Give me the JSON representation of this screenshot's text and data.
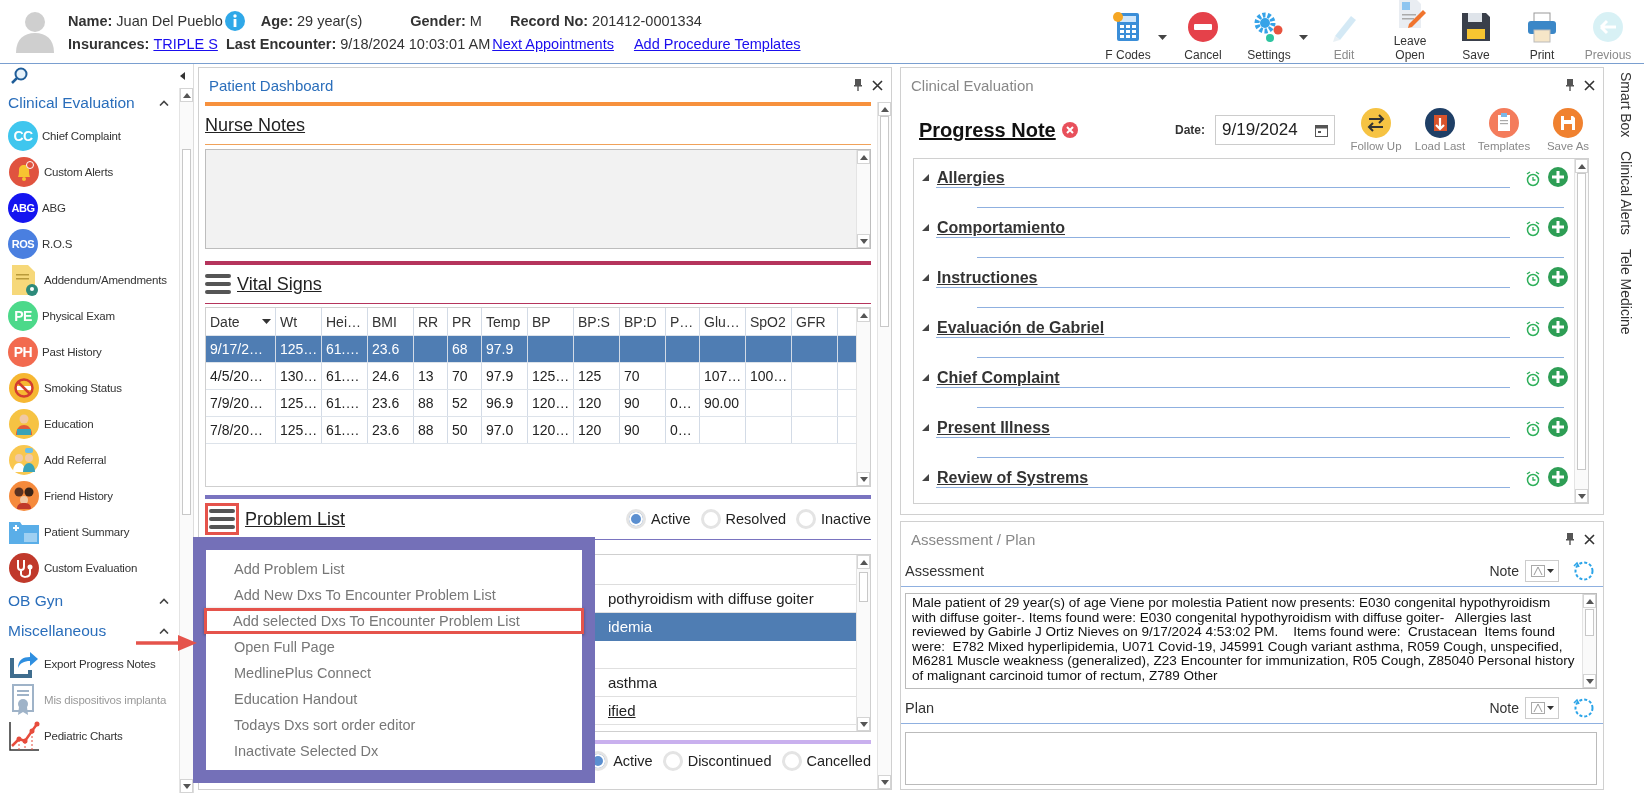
{
  "patient": {
    "name_label": "Name:",
    "name": "Juan Del Pueblo",
    "age_label": "Age:",
    "age": "29 year(s)",
    "gender_label": "Gender:",
    "gender": "M",
    "record_label": "Record No:",
    "record": "201412-0001334",
    "insurance_label": "Insurances:",
    "insurance": "TRIPLE S",
    "last_encounter_label": "Last Encounter:",
    "last_encounter": "9/18/2024 10:03:01 AM",
    "links": [
      "Next Appointments",
      "Add Procedure Templates"
    ]
  },
  "toolbar": [
    {
      "label": "F Codes",
      "kind": "fcodes",
      "dropdown": true,
      "disabled": false
    },
    {
      "label": "Cancel",
      "kind": "cancel",
      "dropdown": false,
      "disabled": false
    },
    {
      "label": "Settings",
      "kind": "settings",
      "dropdown": true,
      "disabled": false
    },
    {
      "label": "Edit",
      "kind": "edit",
      "dropdown": false,
      "disabled": true
    },
    {
      "label": "Leave Open",
      "kind": "leave",
      "dropdown": false,
      "disabled": false
    },
    {
      "label": "Save",
      "kind": "save",
      "dropdown": false,
      "disabled": false
    },
    {
      "label": "Print",
      "kind": "print",
      "dropdown": false,
      "disabled": false
    },
    {
      "label": "Previous",
      "kind": "previous",
      "dropdown": false,
      "disabled": true
    }
  ],
  "sidebar": {
    "groups": [
      {
        "title": "Clinical Evaluation",
        "expanded": true,
        "items": [
          {
            "label": "Chief Complaint",
            "kind": "badge",
            "badge": "CC",
            "color": "#3fc6ee",
            "disabled": false
          },
          {
            "label": "Custom Alerts",
            "kind": "bell",
            "color": "#e0533f",
            "disabled": false
          },
          {
            "label": "ABG",
            "kind": "badge",
            "badge": "ABG",
            "color": "#1414f0",
            "disabled": false
          },
          {
            "label": "R.O.S",
            "kind": "badge",
            "badge": "ROS",
            "color": "#4a7fe0",
            "disabled": false
          },
          {
            "label": "Addendum/Amendments",
            "kind": "document",
            "color": "#f6d87a",
            "disabled": false
          },
          {
            "label": "Physical Exam",
            "kind": "badge",
            "badge": "PE",
            "color": "#4cd98a",
            "disabled": false
          },
          {
            "label": "Past History",
            "kind": "badge",
            "badge": "PH",
            "color": "#f26a4f",
            "disabled": false
          },
          {
            "label": "Smoking Status",
            "kind": "nosmoking",
            "color": "#f6b732",
            "disabled": false
          },
          {
            "label": "Education",
            "kind": "person",
            "color": "#f6c343",
            "disabled": false
          },
          {
            "label": "Add Referral",
            "kind": "people",
            "color": "#f9c74f",
            "disabled": false
          },
          {
            "label": "Friend History",
            "kind": "family",
            "color": "#f58a3c",
            "disabled": false
          },
          {
            "label": "Patient Summary",
            "kind": "folder",
            "color": "#5aaee8",
            "disabled": false
          },
          {
            "label": "Custom Evaluation",
            "kind": "stethoscope",
            "color": "#c0392b",
            "disabled": false
          }
        ]
      },
      {
        "title": "OB Gyn",
        "expanded": true
      },
      {
        "title": "Miscellaneous",
        "expanded": true,
        "items": [
          {
            "label": "Export Progress Notes",
            "kind": "export",
            "color": "#3f6d8e",
            "disabled": false
          },
          {
            "label": "Mis dispositivos implanta",
            "kind": "certificate",
            "color": "#9fb3c8",
            "disabled": true
          },
          {
            "label": "Pediatric Charts",
            "kind": "chart",
            "color": "#e74c3c",
            "disabled": false
          }
        ]
      }
    ]
  },
  "dashboard": {
    "title": "Patient Dashboard",
    "nurse_notes": {
      "title": "Nurse Notes"
    },
    "vital_signs": {
      "title": "Vital Signs",
      "columns": [
        "Date",
        "Wt",
        "Hei…",
        "BMI",
        "RR",
        "PR",
        "Temp",
        "BP",
        "BP:S",
        "BP:D",
        "P…",
        "Glu…",
        "SpO2",
        "GFR"
      ],
      "rows": [
        {
          "selected": true,
          "cells": [
            "9/17/2…",
            "125…",
            "61.…",
            "23.6",
            null,
            "68",
            "97.9",
            null,
            null,
            null,
            null,
            null,
            null,
            null
          ]
        },
        {
          "selected": false,
          "cells": [
            "4/5/20…",
            "130…",
            "61.…",
            "24.6",
            "13",
            "70",
            "97.9",
            "125…",
            "125",
            "70",
            null,
            "107…",
            "100…",
            null
          ]
        },
        {
          "selected": false,
          "cells": [
            "7/9/20…",
            "125…",
            "61.…",
            "23.6",
            "88",
            "52",
            "96.9",
            "120…",
            "120",
            "90",
            "0…",
            "90.00",
            null,
            null
          ]
        },
        {
          "selected": false,
          "cells": [
            "7/8/20…",
            "125…",
            "61.…",
            "23.6",
            "88",
            "50",
            "97.0",
            "120…",
            "120",
            "90",
            "0…",
            null,
            null,
            null
          ]
        }
      ]
    },
    "problem_list": {
      "title": "Problem List",
      "menu_button_highlighted": true,
      "filters": [
        {
          "label": "Active",
          "selected": true
        },
        {
          "label": "Resolved",
          "selected": false
        },
        {
          "label": "Inactive",
          "selected": false
        }
      ],
      "rows": [
        {
          "text": "pothyroidism with diffuse goiter",
          "selected": false,
          "underlined": false
        },
        {
          "text": "idemia",
          "selected": true,
          "underlined": false
        },
        {
          "text": null,
          "selected": false
        },
        {
          "text": "asthma",
          "selected": false,
          "underlined": false
        },
        {
          "text": "ified",
          "selected": false,
          "underlined": true
        }
      ],
      "menu": [
        {
          "label": "Add Problem List",
          "highlighted": false
        },
        {
          "label": "Add New Dxs To Encounter Problem List",
          "highlighted": false
        },
        {
          "label": "Add selected Dxs To Encounter Problem List",
          "highlighted": true
        },
        {
          "label": "Open Full Page",
          "highlighted": false
        },
        {
          "label": "MedlinePlus Connect",
          "highlighted": false
        },
        {
          "label": "Education Handout",
          "highlighted": false
        },
        {
          "label": "Todays Dxs sort order editor",
          "highlighted": false
        },
        {
          "label": "Inactivate Selected Dx",
          "highlighted": false
        }
      ]
    },
    "medications": {
      "filters": [
        {
          "label": "Active",
          "selected": true
        },
        {
          "label": "Discontinued",
          "selected": false
        },
        {
          "label": "Cancelled",
          "selected": false
        }
      ]
    }
  },
  "clinical_evaluation": {
    "title": "Clinical Evaluation",
    "note_title": "Progress Note",
    "date_label": "Date:",
    "date": "9/19/2024",
    "actions": [
      {
        "label": "Follow Up",
        "kind": "follow"
      },
      {
        "label": "Load Last",
        "kind": "load"
      },
      {
        "label": "Templates",
        "kind": "templates"
      },
      {
        "label": "Save As",
        "kind": "saveas"
      }
    ],
    "sections": [
      {
        "title": "Allergies",
        "expanded": true
      },
      {
        "title": "Comportamiento",
        "expanded": true
      },
      {
        "title": "Instructiones",
        "expanded": true
      },
      {
        "title": "Evaluación de Gabriel",
        "expanded": true
      },
      {
        "title": "Chief Complaint",
        "expanded": true
      },
      {
        "title": "Present Illness",
        "expanded": true
      },
      {
        "title": "Review of Systrems",
        "expanded": true
      }
    ]
  },
  "assessment_plan": {
    "title": "Assessment / Plan",
    "assessment": {
      "label": "Assessment",
      "note_label": "Note",
      "text": "Male patient of 29 year(s) of age Viene por molestia Patient now presents: E030 congenital hypothyroidism with diffuse goiter-. Items found were: E030 congenital hypothyroidism with diffuse goiter-   Allergies last reviewed by Gabirle J Ortiz Nieves on 9/17/2024 4:53:02 PM.    Items found were:  Crustacean  Items found were:  E782 Mixed hyperlipidemia, U071 Covid-19, J45991 Cough variant asthma, R059 Cough, unspecified, M6281 Muscle weakness (generalized), Z23 Encounter for immunization, R05 Cough, Z85040 Personal history of malignant carcinoid tumor of rectum, Z789 Other"
    },
    "plan": {
      "label": "Plan",
      "note_label": "Note"
    }
  },
  "side_tabs": [
    "Smart Box",
    "Clinical Alerts",
    "Tele Medicine"
  ]
}
